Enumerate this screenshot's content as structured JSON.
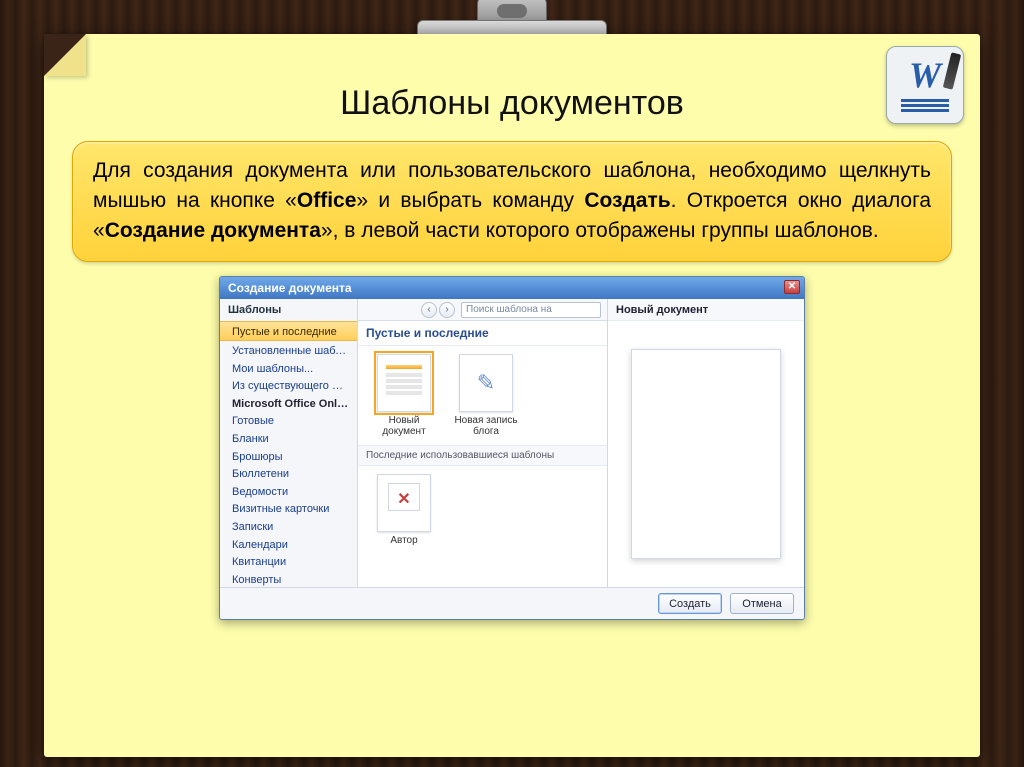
{
  "slide": {
    "title": "Шаблоны документов",
    "desc_parts": {
      "p1": "Для создания документа или пользовательского шаблона, необходимо щелкнуть мышью на кнопке «",
      "b1": "Office",
      "p2": "» и выбрать команду ",
      "b2": "Создать",
      "p3": ". Откроется окно диалога «",
      "b3": "Создание документа",
      "p4": "», в левой части которого отображены группы шаблонов."
    }
  },
  "dialog": {
    "title": "Создание документа",
    "search_placeholder": "Поиск шаблона на",
    "sidebar": {
      "header": "Шаблоны",
      "items": [
        "Пустые и последние",
        "Установленные шаблоны",
        "Мои шаблоны...",
        "Из существующего документа..."
      ],
      "online_header": "Microsoft Office Online",
      "online_items": [
        "Готовые",
        "Бланки",
        "Брошюры",
        "Бюллетени",
        "Ведомости",
        "Визитные карточки",
        "Записки",
        "Календари",
        "Квитанции",
        "Конверты"
      ]
    },
    "middle": {
      "group1": "Пустые и последние",
      "tpl_new_doc": "Новый документ",
      "tpl_blog": "Новая запись блога",
      "group2": "Последние использовавшиеся шаблоны",
      "tpl_author": "Автор"
    },
    "preview_header": "Новый документ",
    "buttons": {
      "create": "Создать",
      "cancel": "Отмена"
    }
  }
}
